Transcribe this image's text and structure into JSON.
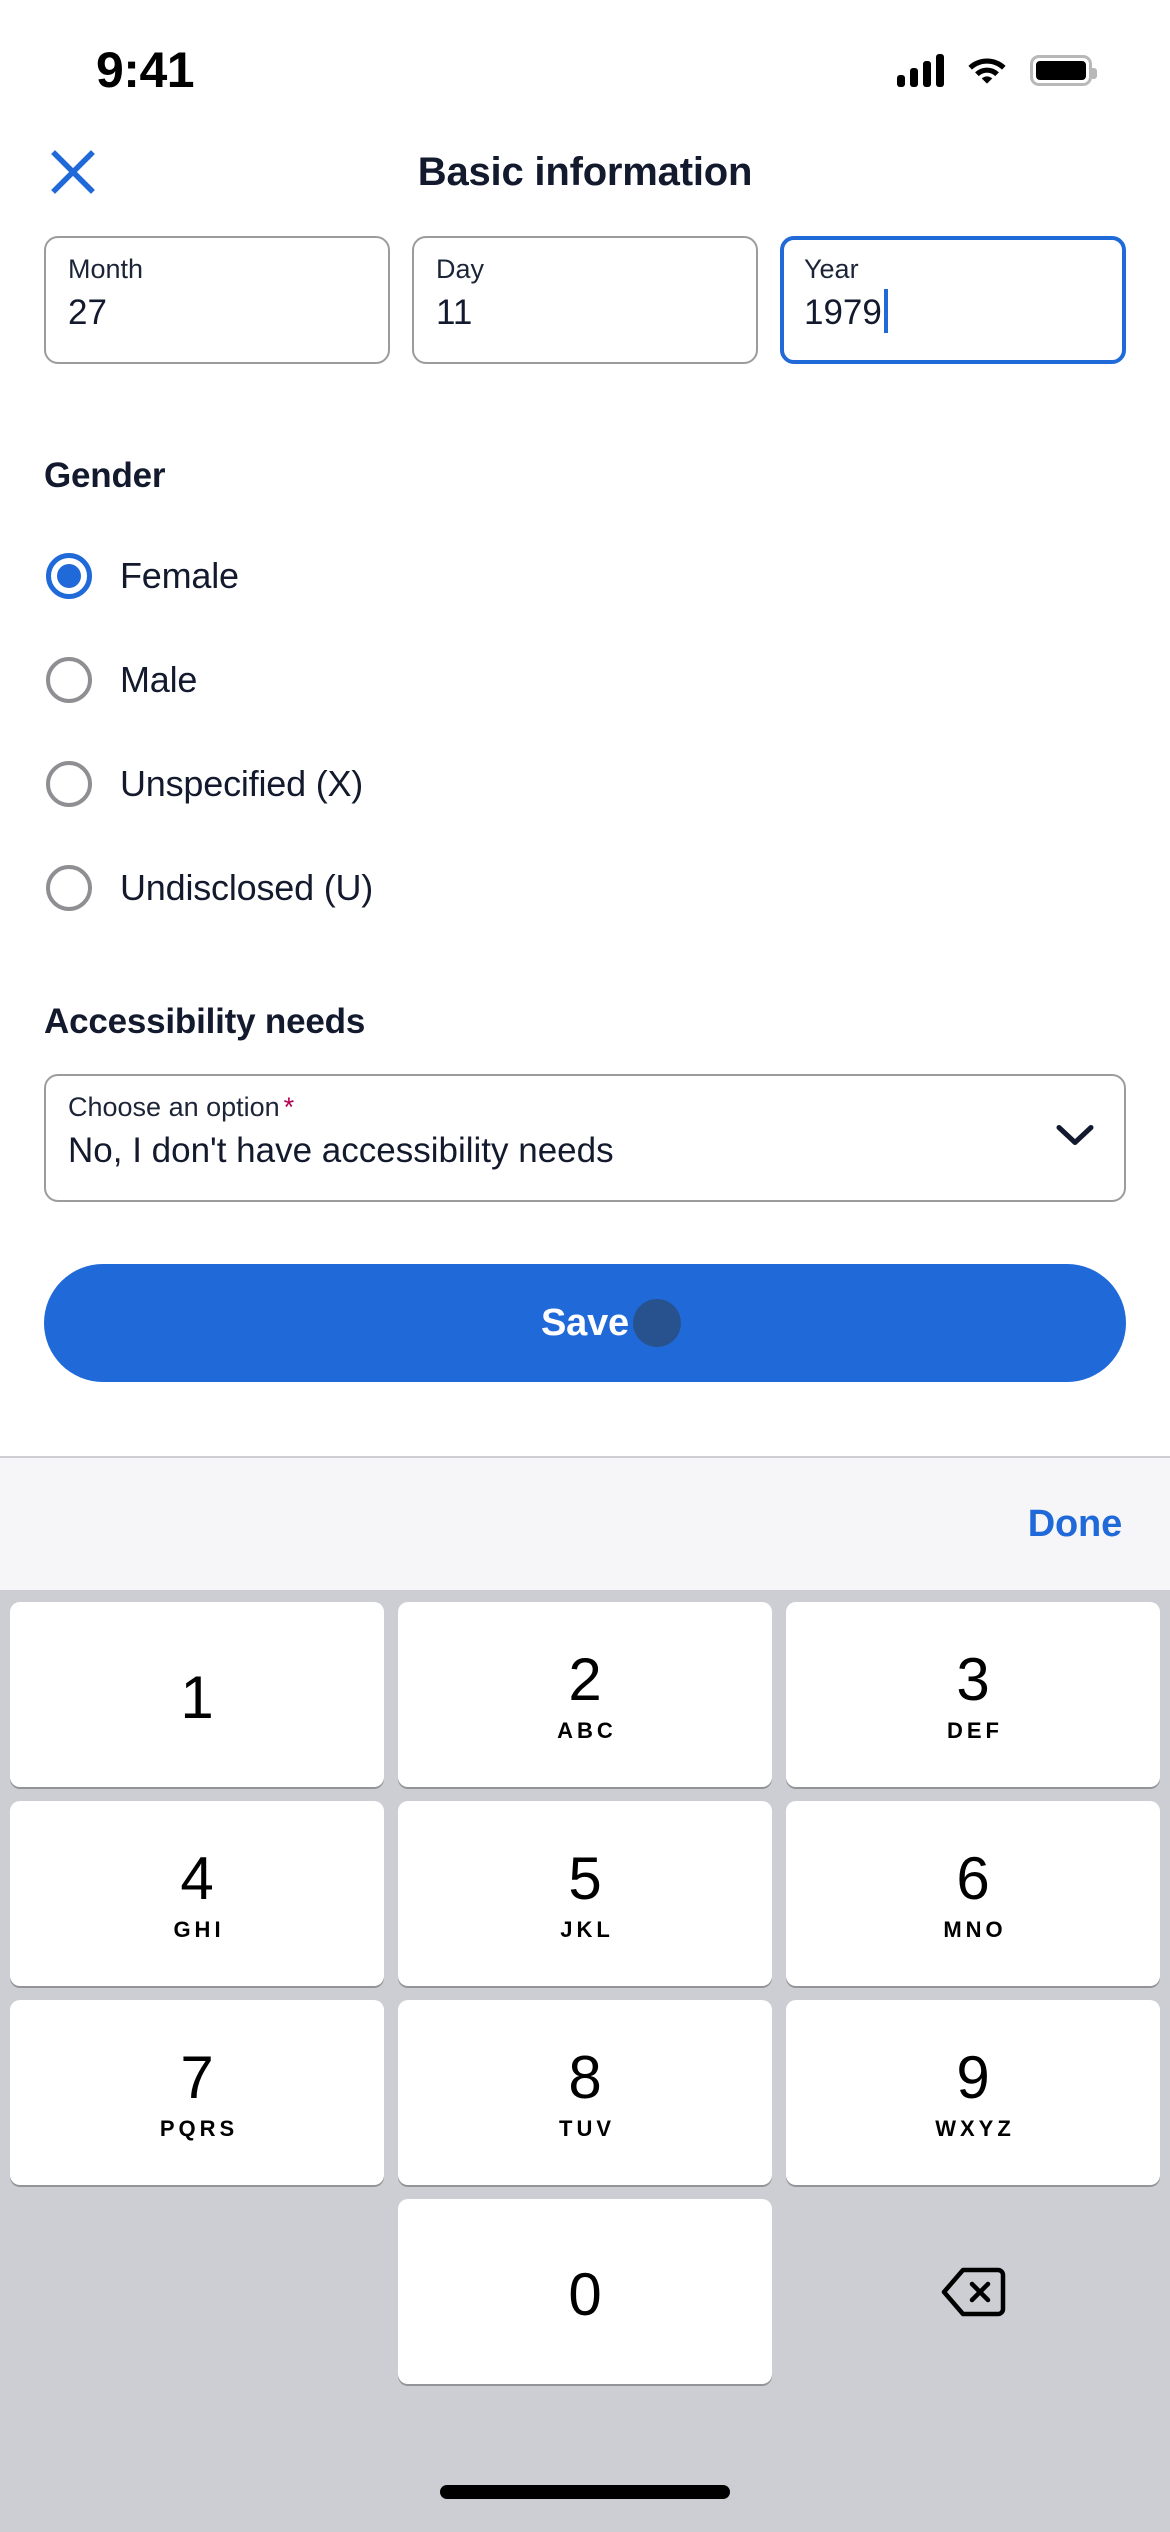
{
  "status_bar": {
    "time": "9:41",
    "signal_icon": "cellular-signal-icon",
    "wifi_icon": "wifi-icon",
    "battery_icon": "battery-full-icon"
  },
  "header": {
    "close_icon": "close-x-icon",
    "title": "Basic information"
  },
  "date_fields": [
    {
      "label": "Month",
      "value": "27",
      "focused": false
    },
    {
      "label": "Day",
      "value": "11",
      "focused": false
    },
    {
      "label": "Year",
      "value": "1979",
      "focused": true
    }
  ],
  "gender": {
    "title": "Gender",
    "options": [
      {
        "label": "Female",
        "selected": true
      },
      {
        "label": "Male",
        "selected": false
      },
      {
        "label": "Unspecified (X)",
        "selected": false
      },
      {
        "label": "Undisclosed (U)",
        "selected": false
      }
    ]
  },
  "accessibility": {
    "title": "Accessibility needs",
    "select_label": "Choose an option",
    "required_marker": "*",
    "selected_value": "No, I don't have accessibility needs",
    "chevron_icon": "chevron-down-icon"
  },
  "save_button": {
    "label": "Save",
    "touch_indicator": "touch-point-indicator"
  },
  "keyboard": {
    "done_label": "Done",
    "rows": [
      [
        {
          "num": "1",
          "sub": ""
        },
        {
          "num": "2",
          "sub": "ABC"
        },
        {
          "num": "3",
          "sub": "DEF"
        }
      ],
      [
        {
          "num": "4",
          "sub": "GHI"
        },
        {
          "num": "5",
          "sub": "JKL"
        },
        {
          "num": "6",
          "sub": "MNO"
        }
      ],
      [
        {
          "num": "7",
          "sub": "PQRS"
        },
        {
          "num": "8",
          "sub": "TUV"
        },
        {
          "num": "9",
          "sub": "WXYZ"
        }
      ],
      [
        {
          "num": "",
          "sub": "",
          "blank": true
        },
        {
          "num": "0",
          "sub": ""
        },
        {
          "num": "",
          "sub": "",
          "delete": true,
          "icon": "backspace-delete-icon"
        }
      ]
    ]
  },
  "colors": {
    "accent_blue": "#2069d8",
    "text_dark": "#131A2E",
    "border_gray": "#9c9c9c",
    "required_red": "#b4004e",
    "keyboard_bg": "#cdced3",
    "accessory_bg": "#f6f6f8"
  },
  "home_indicator": "home-indicator-bar"
}
